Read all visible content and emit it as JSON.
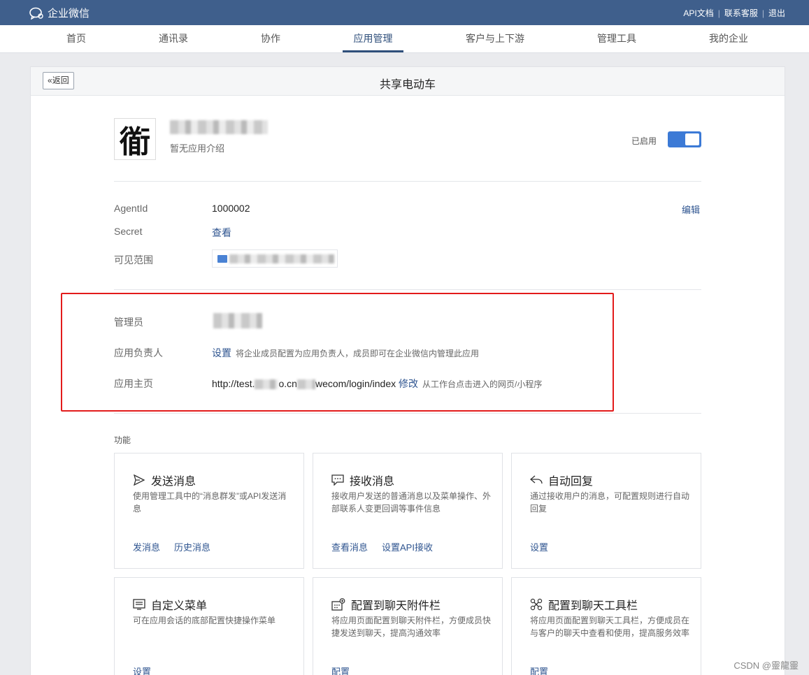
{
  "topbar": {
    "brand": "企业微信",
    "links": [
      "API文档",
      "联系客服",
      "退出"
    ],
    "separator": "|"
  },
  "nav": {
    "tabs": [
      "首页",
      "通讯录",
      "协作",
      "应用管理",
      "客户与上下游",
      "管理工具",
      "我的企业"
    ],
    "active": "应用管理"
  },
  "panel": {
    "back_label": "返回",
    "title": "共享电动车"
  },
  "app": {
    "logo_char": "衜",
    "description": "暂无应用介绍",
    "status_label": "已启用",
    "enabled": true
  },
  "details": {
    "agentid_label": "AgentId",
    "agentid_value": "1000002",
    "edit_label": "编辑",
    "secret_label": "Secret",
    "secret_action": "查看",
    "scope_label": "可见范围"
  },
  "admin": {
    "admin_label": "管理员",
    "owner_label": "应用负责人",
    "owner_action": "设置",
    "owner_hint": "将企业成员配置为应用负责人，成员即可在企业微信内管理此应用",
    "homepage_label": "应用主页",
    "homepage_url_part1": "http://test.",
    "homepage_url_part2": "o.cn",
    "homepage_url_part3": "wecom/login/index",
    "homepage_action": "修改",
    "homepage_hint": "从工作台点击进入的网页/小程序"
  },
  "features": {
    "label": "功能",
    "cards": [
      {
        "icon": "send-icon",
        "title": "发送消息",
        "desc": "使用管理工具中的“消息群发”或API发送消息",
        "actions": [
          "发消息",
          "历史消息"
        ]
      },
      {
        "icon": "chat-bubble-icon",
        "title": "接收消息",
        "desc": "接收用户发送的普通消息以及菜单操作、外部联系人变更回调等事件信息",
        "actions": [
          "查看消息",
          "设置API接收"
        ]
      },
      {
        "icon": "reply-icon",
        "title": "自动回复",
        "desc": "通过接收用户的消息，可配置规则进行自动回复",
        "actions": [
          "设置"
        ]
      },
      {
        "icon": "menu-icon",
        "title": "自定义菜单",
        "desc": "可在应用会话的底部配置快捷操作菜单",
        "actions": [
          "设置"
        ]
      },
      {
        "icon": "attachment-bar-icon",
        "title": "配置到聊天附件栏",
        "desc": "将应用页面配置到聊天附件栏，方便成员快捷发送到聊天，提高沟通效率",
        "actions": [
          "配置"
        ]
      },
      {
        "icon": "toolbar-icon",
        "title": "配置到聊天工具栏",
        "desc": "将应用页面配置到聊天工具栏，方便成员在与客户的聊天中查看和使用，提高服务效率",
        "actions": [
          "配置"
        ]
      }
    ]
  },
  "watermark": "CSDN @靈龍靈"
}
